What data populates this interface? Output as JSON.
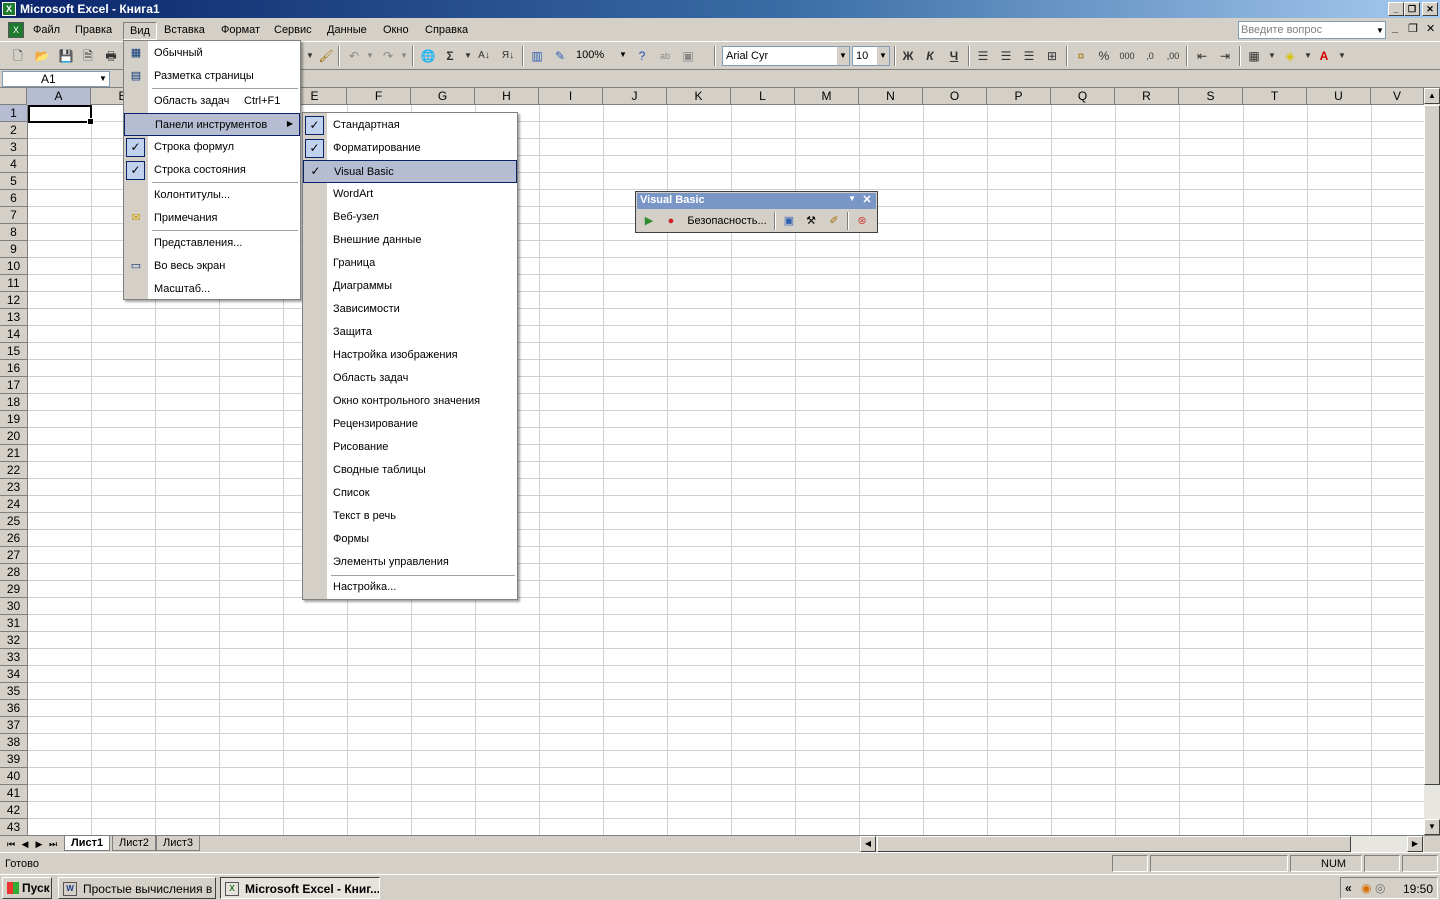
{
  "window": {
    "title": "Microsoft Excel - Книга1"
  },
  "menubar": {
    "items": [
      "Файл",
      "Правка",
      "Вид",
      "Вставка",
      "Формат",
      "Сервис",
      "Данные",
      "Окно",
      "Справка"
    ],
    "ask_placeholder": "Введите вопрос"
  },
  "toolbar": {
    "zoom": "100%",
    "font": "Arial Cyr",
    "size": "10",
    "bold": "Ж",
    "italic": "К",
    "underline": "Ч",
    "percent": "%",
    "thousands": "000",
    "autosum": "Σ",
    "sort_asc": "А↓",
    "sort_desc": "Я↓"
  },
  "formula_bar": {
    "name_box": "A1"
  },
  "columns": [
    "A",
    "B",
    "C",
    "D",
    "E",
    "F",
    "G",
    "H",
    "I",
    "J",
    "K",
    "L",
    "M",
    "N",
    "O",
    "P",
    "Q",
    "R",
    "S",
    "T",
    "U",
    "V"
  ],
  "rows": [
    "1",
    "2",
    "3",
    "4",
    "5",
    "6",
    "7",
    "8",
    "9",
    "10",
    "11",
    "12",
    "13",
    "14",
    "15",
    "16",
    "17",
    "18",
    "19",
    "20",
    "21",
    "22",
    "23",
    "24",
    "25",
    "26",
    "27",
    "28",
    "29",
    "30",
    "31",
    "32",
    "33",
    "34",
    "35",
    "36",
    "37",
    "38",
    "39",
    "40",
    "41",
    "42",
    "43"
  ],
  "view_menu": {
    "items": [
      {
        "label": "Обычный",
        "icon": "normal-view-icon"
      },
      {
        "label": "Разметка страницы",
        "icon": "page-layout-icon"
      },
      {
        "label": "Область задач",
        "shortcut": "Ctrl+F1"
      },
      {
        "label": "Панели инструментов",
        "submenu": true
      },
      {
        "label": "Строка формул",
        "checked": true
      },
      {
        "label": "Строка состояния",
        "checked": true
      },
      {
        "label": "Колонтитулы..."
      },
      {
        "label": "Примечания",
        "icon": "comments-icon"
      },
      {
        "label": "Представления..."
      },
      {
        "label": "Во весь экран",
        "icon": "full-screen-icon"
      },
      {
        "label": "Масштаб..."
      }
    ]
  },
  "toolbars_submenu": {
    "items": [
      {
        "label": "Стандартная",
        "checked": true
      },
      {
        "label": "Форматирование",
        "checked": true
      },
      {
        "label": "Visual Basic",
        "checked": true,
        "highlighted": true
      },
      {
        "label": "WordArt"
      },
      {
        "label": "Веб-узел"
      },
      {
        "label": "Внешние данные"
      },
      {
        "label": "Граница"
      },
      {
        "label": "Диаграммы"
      },
      {
        "label": "Зависимости"
      },
      {
        "label": "Защита"
      },
      {
        "label": "Настройка изображения"
      },
      {
        "label": "Область задач"
      },
      {
        "label": "Окно контрольного значения"
      },
      {
        "label": "Рецензирование"
      },
      {
        "label": "Рисование"
      },
      {
        "label": "Сводные таблицы"
      },
      {
        "label": "Список"
      },
      {
        "label": "Текст в речь"
      },
      {
        "label": "Формы"
      },
      {
        "label": "Элементы управления"
      },
      {
        "label": "Настройка..."
      }
    ]
  },
  "vb_toolbar": {
    "title": "Visual Basic",
    "security_label": "Безопасность..."
  },
  "sheets": {
    "tabs": [
      "Лист1",
      "Лист2",
      "Лист3"
    ],
    "active": "Лист1"
  },
  "statusbar": {
    "status": "Готово",
    "num": "NUM"
  },
  "taskbar": {
    "start": "Пуск",
    "tasks": [
      "Простые вычисления в ...",
      "Microsoft Excel - Книг..."
    ],
    "clock": "19:50"
  }
}
